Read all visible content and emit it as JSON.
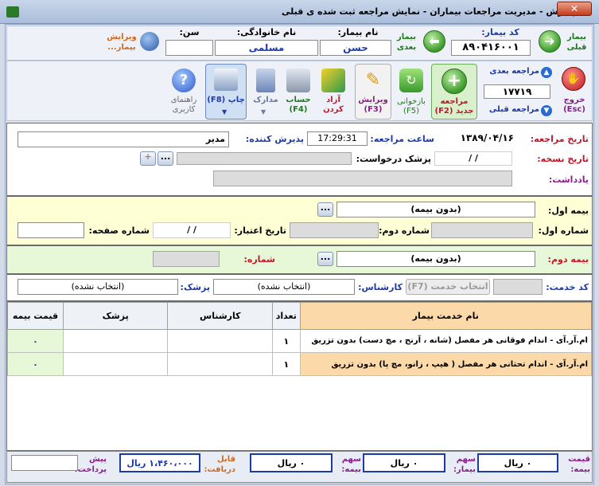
{
  "window": {
    "title": "پذیرش - مدیریت مراجعات بیماران - نمایش مراجعه ثبت شده ی قبلی",
    "close_label": "✕"
  },
  "patient": {
    "prev_patient": "بیمار قبلی",
    "next_patient": "بیمار بعدی",
    "code_label": "کد بیمار:",
    "code": "۸۹۰۴۱۶۰۰۱",
    "name_label": "نام بیمار:",
    "name": "حسن",
    "family_label": "نام خانوادگی:",
    "family": "مسلمی",
    "age_label": "سن:",
    "age": "",
    "edit_patient": "ویرایش بیمار..."
  },
  "toolbar": {
    "exit": "خروج (Esc)",
    "next_visit": "مراجعه بعدی",
    "prev_visit": "مراجعه قبلی",
    "visit_number": "۱۷۷۱۹",
    "new_visit": "مراجعه جدید (F2)",
    "reopen": "بازخوانی (F5)",
    "edit": "ویرایش (F3)",
    "release": "آزاد کردن",
    "account": "حساب (F4)",
    "documents": "مدارک",
    "print": "چاپ (F8)",
    "help": "راهنمای کاربری"
  },
  "visit": {
    "date_label": "تاریخ مراجعه:",
    "date": "۱۳۸۹/۰۴/۱۶",
    "time_label": "ساعت مراجعه:",
    "time": "17:29:31",
    "receptionist_label": "پذیرش کننده:",
    "receptionist": "مدیر",
    "rx_date_label": "تاریخ نسخه:",
    "rx_date": "/ /",
    "requesting_doctor_label": "پزشک درخواست:",
    "requesting_doctor": "",
    "note_label": "یادداشت:",
    "note": ""
  },
  "insurance1": {
    "label": "بیمه اول:",
    "value": "(بدون بیمه)",
    "number1_label": "شماره اول:",
    "number1": "",
    "number2_label": "شماره دوم:",
    "number2": "",
    "validity_label": "تاریخ اعتبار:",
    "validity": "/ /",
    "page_label": "شماره صفحه:",
    "page": ""
  },
  "insurance2": {
    "label": "بیمه دوم:",
    "value": "(بدون بیمه)",
    "number_label": "شماره:",
    "number": ""
  },
  "service": {
    "code_label": "کد خدمت:",
    "code": "",
    "select_btn": "انتخاب خدمت (F7)",
    "expert_label": "کارشناس:",
    "expert": "(انتخاب نشده)",
    "doctor_label": "پزشک:",
    "doctor": "(انتخاب نشده)"
  },
  "grid": {
    "headers": [
      "نام خدمت بیمار",
      "تعداد",
      "کارشناس",
      "پزشک",
      "قیمت بیمه"
    ],
    "rows": [
      {
        "service": "ام.آر.آی - اندام فوقانی هر مفصل (شانه ، آرنج ، مچ دست) بدون تزریق",
        "qty": "۱",
        "expert": "",
        "doctor": "",
        "price": "۰"
      },
      {
        "service": "ام.آر.آی - اندام تحتانی هر مفصل ( هیپ ، زانو، مچ پا) بدون تزریق",
        "qty": "۱",
        "expert": "",
        "doctor": "",
        "price": "۰"
      }
    ]
  },
  "totals": {
    "ins_price_label": "قیمت بیمه:",
    "ins_price": "۰ ریال",
    "patient_share_label": "سهم بیمار:",
    "patient_share": "۰ ریال",
    "ins_share_label": "سهم بیمه:",
    "ins_share": "۰ ریال",
    "receivable_label": "قابل دریافت:",
    "receivable": "۱،۴۶۰،۰۰۰ ریال",
    "prepay_label": "پیش پرداخت:",
    "prepay": ""
  },
  "colors": {
    "section_yellow": "#ffffd6",
    "section_green": "#e6f8d8",
    "row_highlight": "#fbd9a8"
  }
}
